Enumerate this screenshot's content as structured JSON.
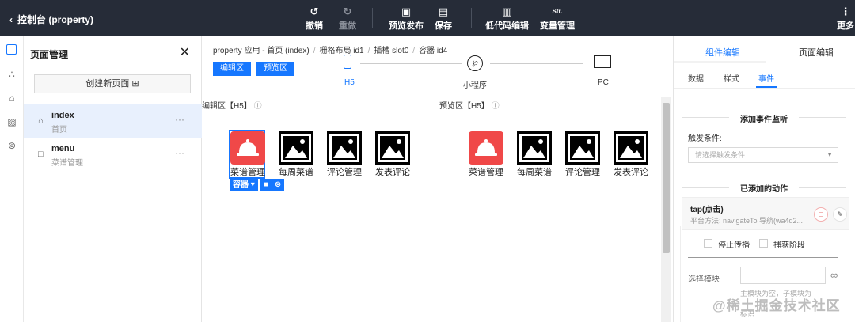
{
  "topbar": {
    "title": "控制台 (property)",
    "buttons": {
      "undo": "撤销",
      "redo": "重做",
      "preview_publish": "预览发布",
      "save": "保存",
      "lowcode": "低代码编辑",
      "str_icon_text": "Str.",
      "variables": "变量管理",
      "more": "更多"
    }
  },
  "page_panel": {
    "title": "页面管理",
    "create_button": "创建新页面",
    "pages": [
      {
        "name": "index",
        "sub": "首页",
        "active": true
      },
      {
        "name": "menu",
        "sub": "菜谱管理",
        "active": false
      }
    ]
  },
  "canvas": {
    "breadcrumb": [
      "property 应用 - 首页 (index)",
      "栅格布局 id1",
      "插槽 slot0",
      "容器 id4"
    ],
    "edit_mode": "编辑区",
    "preview_mode": "预览区",
    "devices": [
      "H5",
      "小程序",
      "PC"
    ],
    "edit_area_title": "编辑区【H5】",
    "preview_area_title": "预览区【H5】",
    "tiles": [
      "菜谱管理",
      "每周菜谱",
      "评论管理",
      "发表评论"
    ],
    "container_tag": "容器"
  },
  "right_panel": {
    "tabs": [
      "组件编辑",
      "页面编辑"
    ],
    "sub_tabs": [
      "数据",
      "样式",
      "事件"
    ],
    "add_listener_title": "添加事件监听",
    "trigger_label": "触发条件:",
    "trigger_placeholder": "请选择触发条件",
    "added_actions_title": "已添加的动作",
    "action": {
      "name": "tap(点击)",
      "desc": "平台方法: navigateTo 导航(wa4d2..."
    },
    "stop_propagation": "停止传播",
    "capture_phase": "捕获阶段",
    "select_module_label": "选择模块",
    "module_hint_line1": "主模块为空，子模块为",
    "module_hint_line2": "标识"
  },
  "watermark": "@稀土掘金技术社区",
  "colors": {
    "accent": "#1677ff",
    "topbar": "#262c38",
    "red_tile": "#f04848"
  }
}
